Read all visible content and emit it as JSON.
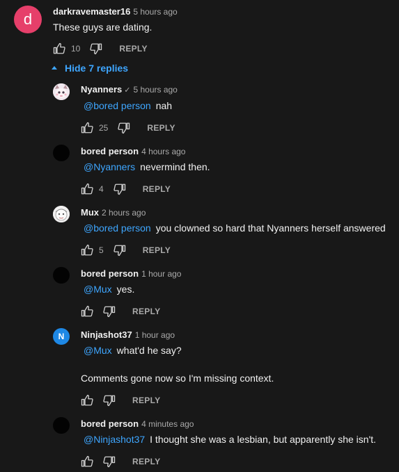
{
  "top_comment": {
    "avatar_letter": "d",
    "author": "darkravemaster16",
    "time": "5 hours ago",
    "text": "These guys are dating.",
    "likes": "10",
    "reply_label": "REPLY"
  },
  "toggle_label": "Hide 7 replies",
  "replies": [
    {
      "author": "Nyanners",
      "verified": "✓",
      "time": "5 hours ago",
      "mention": "@bored person",
      "text": "nah",
      "likes": "25",
      "reply_label": "REPLY"
    },
    {
      "author": "bored person",
      "time": "4 hours ago",
      "mention": "@Nyanners",
      "text": "nevermind then.",
      "likes": "4",
      "reply_label": "REPLY"
    },
    {
      "author": "Mux",
      "time": "2 hours ago",
      "mention": "@bored person",
      "text": "you clowned so hard that Nyanners herself answered",
      "likes": "5",
      "reply_label": "REPLY"
    },
    {
      "author": "bored person",
      "time": "1 hour ago",
      "mention": "@Mux",
      "text": "yes.",
      "likes": "",
      "reply_label": "REPLY"
    },
    {
      "author": "Ninjashot37",
      "avatar_letter": "N",
      "time": "1 hour ago",
      "mention": "@Mux",
      "text": "what'd he say?",
      "text2": "Comments gone now so I'm missing context.",
      "likes": "",
      "reply_label": "REPLY"
    },
    {
      "author": "bored person",
      "time": "4 minutes ago",
      "mention": "@Ninjashot37",
      "text": "I thought she was a lesbian, but apparently she isn't.",
      "likes": "",
      "reply_label": "REPLY"
    }
  ]
}
